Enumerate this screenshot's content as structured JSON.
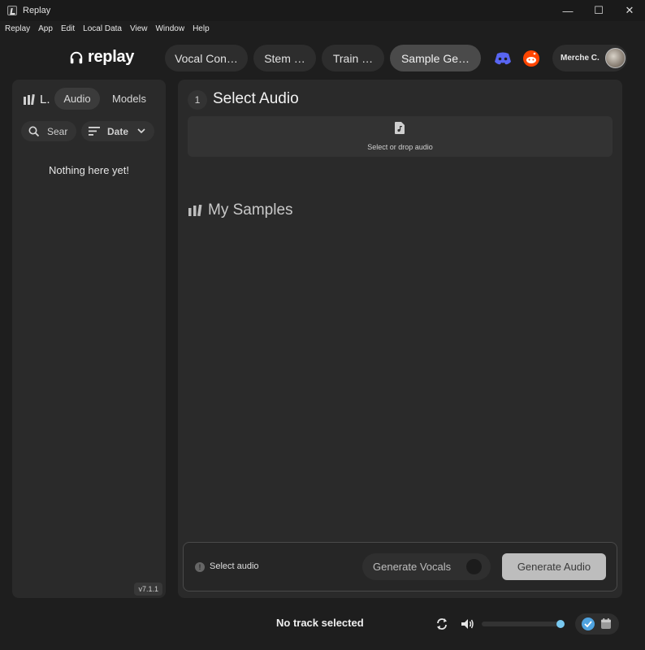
{
  "window": {
    "title": "Replay",
    "minimize": "—",
    "maximize": "☐",
    "close": "✕"
  },
  "menu": [
    "Replay",
    "App",
    "Edit",
    "Local Data",
    "View",
    "Window",
    "Help"
  ],
  "brand": {
    "name": "replay"
  },
  "tabs": [
    {
      "label": "Vocal Con…",
      "active": false
    },
    {
      "label": "Stem …",
      "active": false
    },
    {
      "label": "Train …",
      "active": false
    },
    {
      "label": "Sample Ge…",
      "active": true
    }
  ],
  "social": {
    "discord_icon": "discord-icon",
    "reddit_icon": "reddit-icon"
  },
  "user": {
    "name": "Merche C."
  },
  "library": {
    "label": "L.",
    "segments": [
      {
        "label": "Audio",
        "active": true
      },
      {
        "label": "Models",
        "active": false
      }
    ],
    "search_placeholder": "Sear",
    "sort_label": "Date",
    "empty_message": "Nothing here yet!",
    "version": "v7.1.1"
  },
  "main": {
    "step_number": "1",
    "section_title": "Select Audio",
    "drop_label": "Select or drop audio",
    "samples_title": "My Samples"
  },
  "generate": {
    "info_glyph": "!",
    "status": "Select audio",
    "vocals_label": "Generate Vocals",
    "vocals_enabled": false,
    "generate_button": "Generate Audio"
  },
  "player": {
    "track_label": "No track selected",
    "volume": 1.0
  },
  "colors": {
    "background": "#1e1e1e",
    "panel": "#2a2a2a",
    "accent_blue": "#4fa3e0",
    "discord": "#5865f2",
    "reddit": "#ff4500"
  }
}
